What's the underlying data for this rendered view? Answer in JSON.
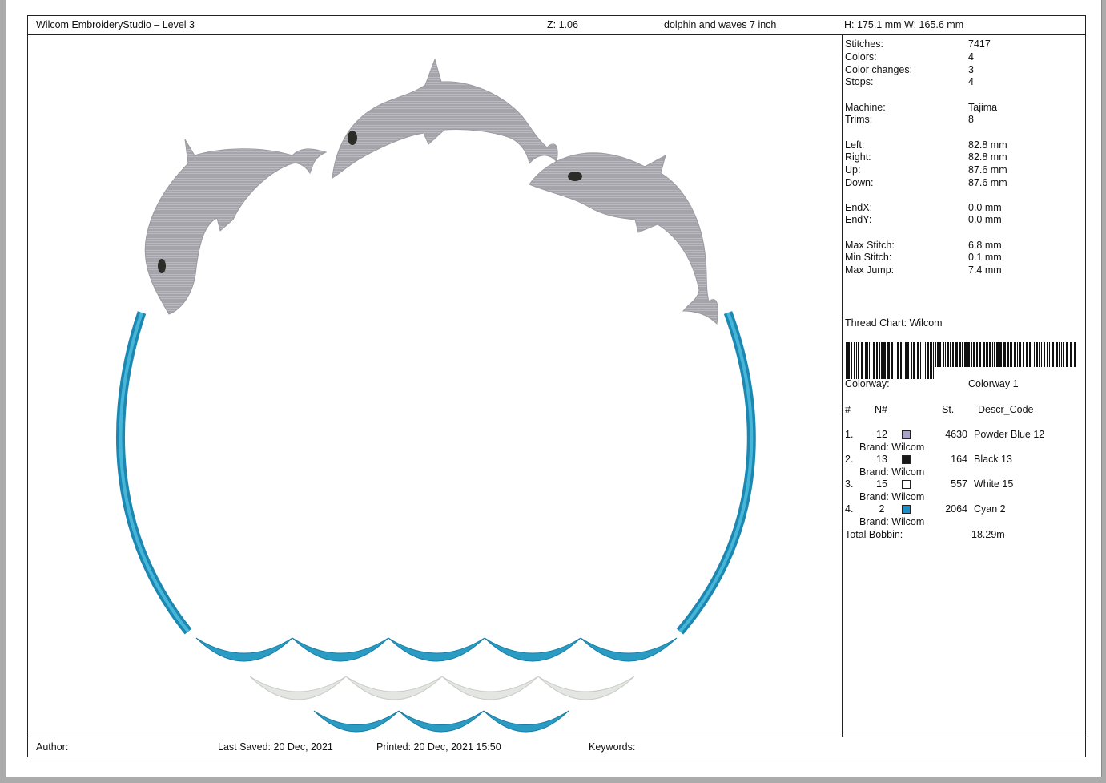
{
  "header": {
    "app_title": "Wilcom EmbroideryStudio – Level 3",
    "zoom": "Z: 1.06",
    "design_name": "dolphin and waves 7 inch",
    "size": "H: 175.1 mm   W: 165.6 mm"
  },
  "stats": [
    {
      "label": "Stitches:",
      "value": "7417"
    },
    {
      "label": "Colors:",
      "value": "4"
    },
    {
      "label": "Color changes:",
      "value": "3"
    },
    {
      "label": "Stops:",
      "value": "4"
    },
    {
      "label": "Machine:",
      "value": "Tajima"
    },
    {
      "label": "Trims:",
      "value": "8"
    },
    {
      "label": "Left:",
      "value": "82.8 mm"
    },
    {
      "label": "Right:",
      "value": "82.8 mm"
    },
    {
      "label": "Up:",
      "value": "87.6 mm"
    },
    {
      "label": "Down:",
      "value": "87.6 mm"
    },
    {
      "label": "EndX:",
      "value": "0.0 mm"
    },
    {
      "label": "EndY:",
      "value": "0.0 mm"
    },
    {
      "label": "Max Stitch:",
      "value": "6.8 mm"
    },
    {
      "label": "Min Stitch:",
      "value": "0.1 mm"
    },
    {
      "label": "Max Jump:",
      "value": "7.4 mm"
    }
  ],
  "thread_chart": "Thread Chart: Wilcom",
  "colorway": {
    "label": "Colorway:",
    "value": "Colorway 1"
  },
  "thread_table": {
    "headers": {
      "num": "#",
      "n": "N#",
      "st": "St.",
      "descr": "Descr_Code"
    },
    "rows": [
      {
        "idx": "1.",
        "n": "12",
        "color": "#a7a3c8",
        "stitches": "4630",
        "descr": "Powder Blue 12",
        "brand": "Brand: Wilcom"
      },
      {
        "idx": "2.",
        "n": "13",
        "color": "#1a1a1a",
        "stitches": "164",
        "descr": "Black 13",
        "brand": "Brand: Wilcom"
      },
      {
        "idx": "3.",
        "n": "15",
        "color": "#ffffff",
        "stitches": "557",
        "descr": "White 15",
        "brand": "Brand: Wilcom"
      },
      {
        "idx": "4.",
        "n": "2",
        "color": "#1a8fc9",
        "stitches": "2064",
        "descr": "Cyan 2",
        "brand": "Brand: Wilcom"
      }
    ],
    "total_label": "Total Bobbin:",
    "total_value": "18.29m"
  },
  "footer": {
    "author": "Author:",
    "last_saved": "Last Saved: 20 Dec, 2021",
    "printed": "Printed: 20 Dec, 2021 15:50",
    "keywords": "Keywords:"
  },
  "colors": {
    "dolphin": "#a4a4aa",
    "ring": "#2a9cc4",
    "wave_white": "#e4e7e2",
    "eye": "#2b2b28"
  },
  "icons": {
    "barcode": "barcode-graphic"
  }
}
